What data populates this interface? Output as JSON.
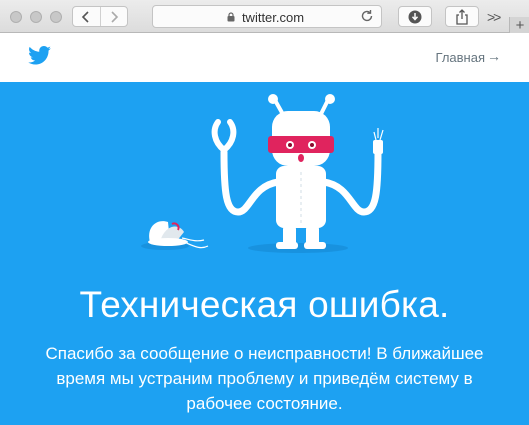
{
  "browser": {
    "url": "twitter.com",
    "back_icon": "chevron-left-icon",
    "forward_icon": "chevron-right-icon",
    "download_icon": "download-icon",
    "share_icon": "share-icon",
    "more_label": ">>",
    "new_tab_label": "+"
  },
  "header": {
    "logo_icon": "twitter-bird-icon",
    "home_label": "Главная",
    "home_arrow": "→",
    "brand_color": "#1da1f2"
  },
  "error": {
    "title": "Техническая ошибка.",
    "description_line1": "Спасибо за сообщение о неисправности! В ближайшее",
    "description_line2": "время мы устраним проблему и приведём систему в",
    "description_line3": "рабочее состояние.",
    "illustration": "broken-robot-illustration"
  }
}
